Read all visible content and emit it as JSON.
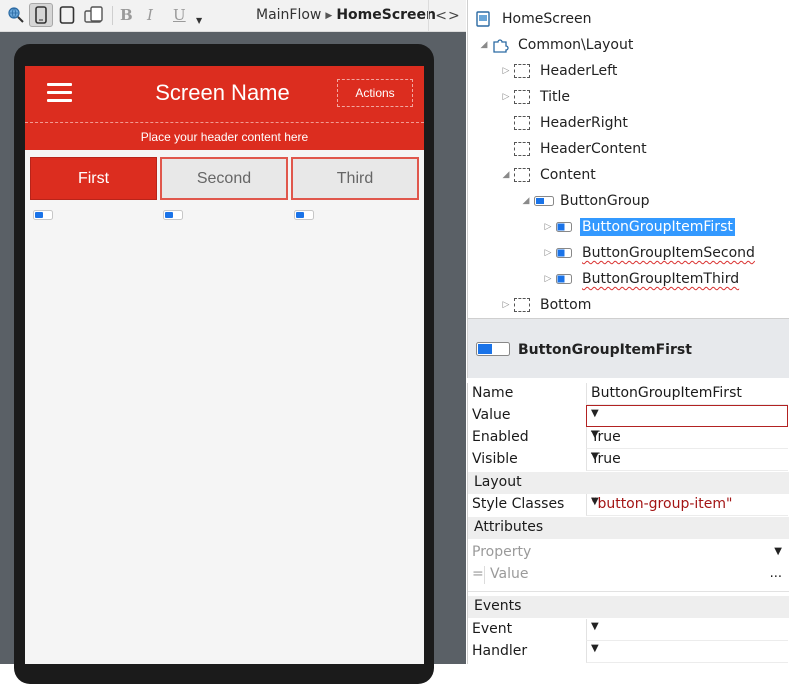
{
  "toolbar": {
    "breadcrumb_parent": "MainFlow",
    "breadcrumb_current": "HomeScreen",
    "code_view_label": "<>",
    "bold_label": "B",
    "italic_label": "I",
    "underline_label": "U"
  },
  "preview": {
    "title": "Screen Name",
    "actions_label": "Actions",
    "header_content": "Place your header content here",
    "buttons": [
      "First",
      "Second",
      "Third"
    ]
  },
  "tree": {
    "nodes": [
      {
        "label": "HomeScreen"
      },
      {
        "label": "Common\\Layout"
      },
      {
        "label": "HeaderLeft"
      },
      {
        "label": "Title"
      },
      {
        "label": "HeaderRight"
      },
      {
        "label": "HeaderContent"
      },
      {
        "label": "Content"
      },
      {
        "label": "ButtonGroup"
      },
      {
        "label": "ButtonGroupItemFirst"
      },
      {
        "label": "ButtonGroupItemSecond"
      },
      {
        "label": "ButtonGroupItemThird"
      },
      {
        "label": "Bottom"
      }
    ]
  },
  "properties": {
    "header": "ButtonGroupItemFirst",
    "rows": [
      {
        "key": "Name",
        "value": "ButtonGroupItemFirst"
      },
      {
        "key": "Value",
        "value": ""
      },
      {
        "key": "Enabled",
        "value": "True"
      },
      {
        "key": "Visible",
        "value": "True"
      }
    ],
    "layout_section": "Layout",
    "style_classes": {
      "key": "Style Classes",
      "value": "\"button-group-item\""
    },
    "attributes_section": "Attributes",
    "attribute_property": "Property",
    "attribute_eq": "=",
    "attribute_value": "Value",
    "attribute_more": "...",
    "events_section": "Events",
    "event": {
      "key": "Event",
      "value": ""
    },
    "handler": {
      "key": "Handler",
      "value": ""
    }
  },
  "colors": {
    "brand_red": "#dc2d1f",
    "selection_blue": "#3399ff",
    "toggle_blue": "#1a73e8"
  }
}
